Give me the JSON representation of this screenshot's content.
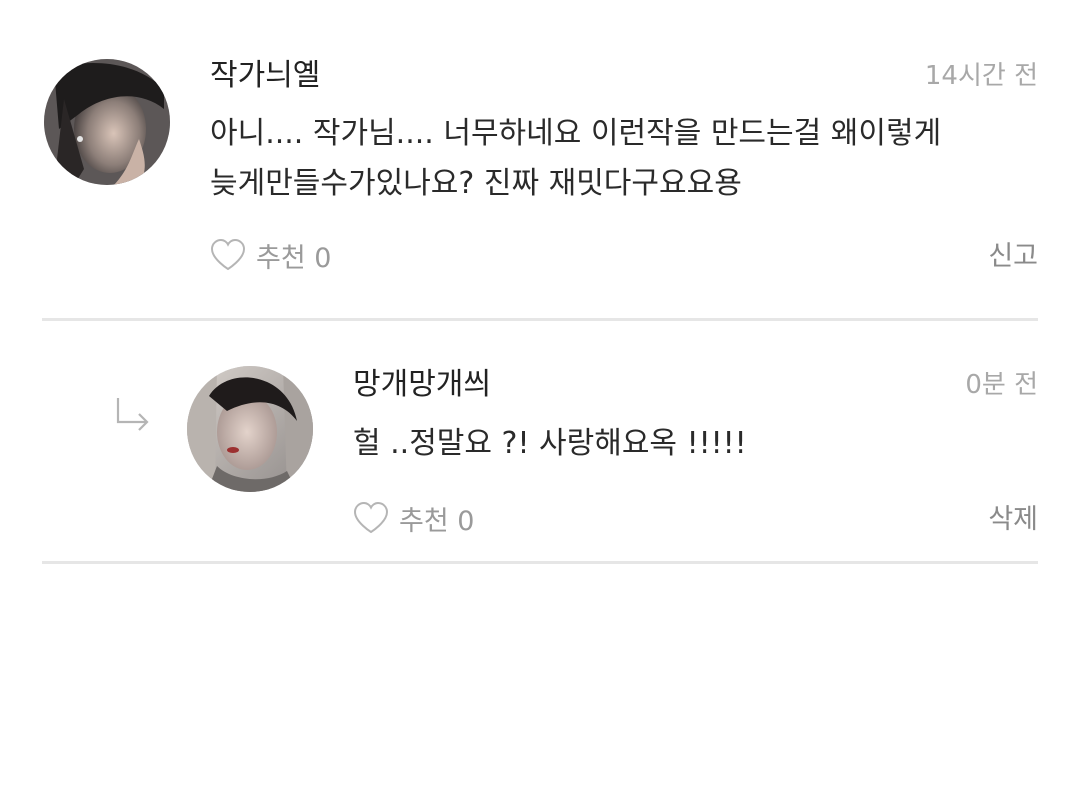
{
  "comments": [
    {
      "username": "작가늬옐",
      "time": "14시간 전",
      "text_line1": "아니.... 작가님.... 너무하네요 이런작을 만드는걸 왜이렇게",
      "text_line2": "늦게만들수가있나요? 진짜 재밋다구요요용",
      "like_label": "추천 0",
      "like_count": 0,
      "action_label": "신고",
      "avatar_icon": "profile-photo"
    }
  ],
  "replies": [
    {
      "username": "망개망개씌",
      "time": "0분 전",
      "text": "헐 ..정말요 ?! 사랑해요옥 !!!!!",
      "like_label": "추천 0",
      "like_count": 0,
      "action_label": "삭제",
      "avatar_icon": "profile-photo",
      "reply_indicator_icon": "reply-arrow-icon"
    }
  ],
  "colors": {
    "text_primary": "#222222",
    "text_muted": "#a8a8a8",
    "action_text": "#8a8a8a",
    "divider": "#e6e6e6",
    "icon_stroke": "#b5b5b5"
  }
}
